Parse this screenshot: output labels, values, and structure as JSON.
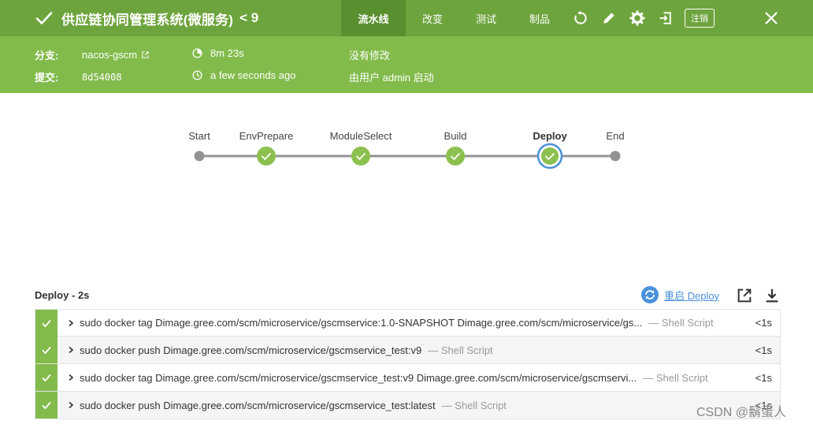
{
  "header": {
    "title": "供应链协同管理系统(微服务)",
    "run_number": "< 9",
    "tabs": [
      {
        "label": "流水线",
        "active": true
      },
      {
        "label": "改变",
        "active": false
      },
      {
        "label": "测试",
        "active": false
      },
      {
        "label": "制品",
        "active": false
      }
    ],
    "logout_label": "注销",
    "icons": [
      "replay-icon",
      "pencil-icon",
      "gear-icon",
      "exit-icon",
      "close-icon"
    ],
    "bar_color": "#6ea43d",
    "info_color": "#82bb4b"
  },
  "info": {
    "branch_label": "分支:",
    "branch_value": "nacos-gscm",
    "commit_label": "提交:",
    "commit_value": "8d54008",
    "duration": "8m 23s",
    "time_ago": "a few seconds ago",
    "changes": "没有修改",
    "started_by": "由用户 admin 启动"
  },
  "pipeline": {
    "stages": [
      {
        "name": "Start",
        "status": "start"
      },
      {
        "name": "EnvPrepare",
        "status": "success"
      },
      {
        "name": "ModuleSelect",
        "status": "success"
      },
      {
        "name": "Build",
        "status": "success"
      },
      {
        "name": "Deploy",
        "status": "success",
        "selected": true
      },
      {
        "name": "End",
        "status": "end"
      }
    ]
  },
  "log": {
    "title": "Deploy - 2s",
    "restart_label": "重启 Deploy",
    "steps": [
      {
        "command": "sudo docker tag Dimage.gree.com/scm/microservice/gscmservice:1.0-SNAPSHOT Dimage.gree.com/scm/microservice/gs...",
        "type": "— Shell Script",
        "duration": "<1s"
      },
      {
        "command": "sudo docker push Dimage.gree.com/scm/microservice/gscmservice_test:v9",
        "type": "— Shell Script",
        "duration": "<1s"
      },
      {
        "command": "sudo docker tag Dimage.gree.com/scm/microservice/gscmservice_test:v9 Dimage.gree.com/scm/microservice/gscmservi...",
        "type": "— Shell Script",
        "duration": "<1s"
      },
      {
        "command": "sudo docker push Dimage.gree.com/scm/microservice/gscmservice_test:latest",
        "type": "— Shell Script",
        "duration": "<1s"
      }
    ]
  },
  "watermark": "CSDN @鬍蛋人"
}
